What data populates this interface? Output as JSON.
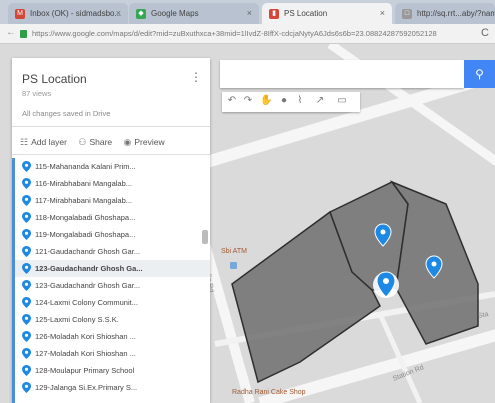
{
  "browser": {
    "tabs": [
      {
        "label": "Inbox (OK) - sidmadsbo...",
        "icon": "gmail-icon",
        "color": "#d44638",
        "active": false
      },
      {
        "label": "Google Maps",
        "icon": "google-maps-icon",
        "color": "#34a853",
        "active": false
      },
      {
        "label": "PS Location",
        "icon": "my-maps-icon",
        "color": "#d44638",
        "active": true
      },
      {
        "label": "http://sq.rrt...aby/?name",
        "icon": "page-icon",
        "color": "#999999",
        "active": false
      }
    ],
    "url": "https://www.google.com/maps/d/edit?mid=zuBxuthxca+38mid=1lIvdZ-8IffX-cdcjaNytyA6Jds6s6b=23.08824287592052128"
  },
  "panel": {
    "title": "PS Location",
    "views": "87 views",
    "saved_status": "All changes saved in Drive",
    "actions": [
      {
        "icon": "add-layer-icon",
        "label": "Add layer"
      },
      {
        "icon": "share-icon",
        "label": "Share"
      },
      {
        "icon": "preview-icon",
        "label": "Preview"
      }
    ],
    "items": [
      "115-Mahananda Kalani Prim...",
      "116-Mirabhabani Mangalab...",
      "117-Mirabhabani Mangalab...",
      "118-Mongalabadi Ghoshapa...",
      "119-Mongalabadi Ghoshapa...",
      "121-Gaudachandr Ghosh Gar...",
      "123-Gaudachandr Ghosh Ga...",
      "123-Gaudachandr Ghosh Gar...",
      "124-Laxmi Colony Communit...",
      "125-Laxmi Colony S.S.K.",
      "126-Moladah Kori Shioshan ...",
      "127-Moladah Kori Shioshan ...",
      "128-Moulapur Primary School",
      "129-Jalanga Si.Ex.Primary S..."
    ],
    "selected_index": 6
  },
  "search": {
    "placeholder": ""
  },
  "toolbar": {
    "icons": [
      "undo-icon",
      "redo-icon",
      "hand-icon",
      "marker-icon",
      "draw-line-icon",
      "directions-icon",
      "ruler-icon"
    ]
  },
  "map": {
    "labels": {
      "atm": "Sbi ATM",
      "road_india": "India Rd",
      "road_station": "Station Rd",
      "road_sta": "Sta",
      "shop": "Radha Rani Cake Shop"
    },
    "colors": {
      "polygon": "#6e6e6e",
      "marker": "#1e88e5",
      "accent": "#4285f4"
    }
  }
}
